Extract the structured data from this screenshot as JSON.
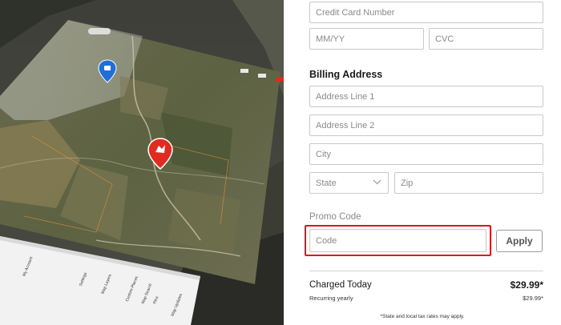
{
  "payment": {
    "card_number_placeholder": "Credit Card Number",
    "expiry_placeholder": "MM/YY",
    "cvc_placeholder": "CVC"
  },
  "billing": {
    "title": "Billing Address",
    "address1_placeholder": "Address Line 1",
    "address2_placeholder": "Address Line 2",
    "city_placeholder": "City",
    "state_placeholder": "State",
    "zip_placeholder": "Zip"
  },
  "promo": {
    "label": "Promo Code",
    "placeholder": "Code",
    "apply_label": "Apply",
    "highlight_color": "#e0141e"
  },
  "summary": {
    "charged_label": "Charged Today",
    "charged_amount": "$29.99*",
    "recurring_label": "Recurring yearly",
    "recurring_amount": "$29.99*",
    "tax_note": "*State and local tax rates may apply."
  },
  "map_promo": {
    "menu_items": [
      "My Account",
      "Settings",
      "Map Layers",
      "Custom Places",
      "Map Search",
      "Pins",
      "Map Updates"
    ],
    "pin_colors": {
      "blue": "#1f6fd6",
      "red": "#e02b20"
    }
  }
}
